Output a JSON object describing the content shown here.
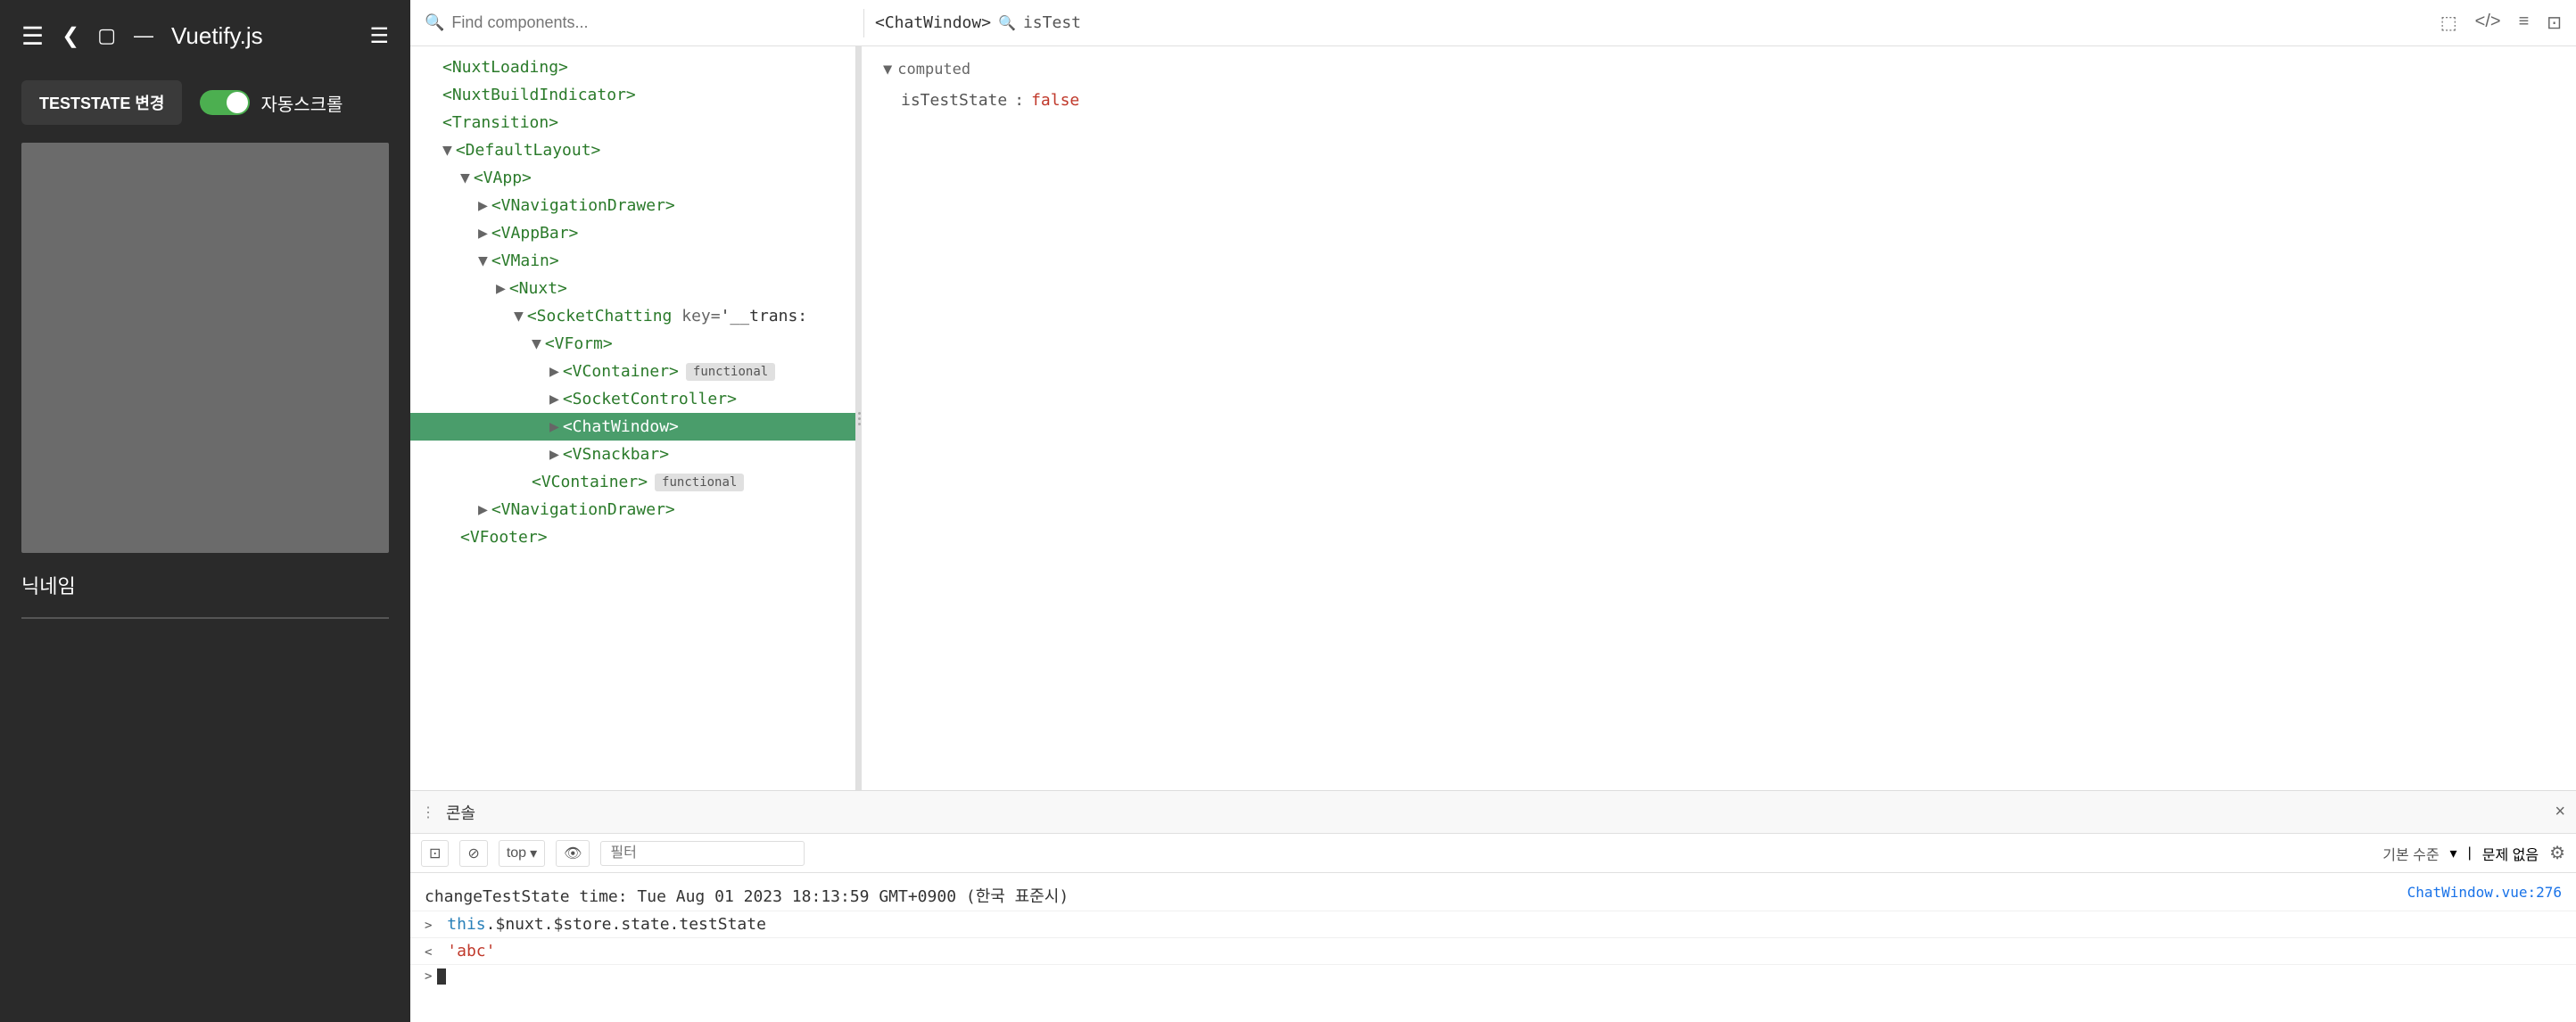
{
  "left_panel": {
    "title": "Vuetify.js",
    "test_button_label": "TESTSTATE 변경",
    "toggle_label": "자동스크롤",
    "nickname_label": "닉네임"
  },
  "devtools": {
    "search_placeholder": "Find components...",
    "breadcrumb_component": "<ChatWindow>",
    "breadcrumb_prop": "isTest",
    "component_details": {
      "section": "computed",
      "prop_key": "isTestState",
      "prop_value": "false"
    }
  },
  "component_tree": {
    "items": [
      {
        "indent": 2,
        "label": "<NuxtLoading>",
        "arrow": "",
        "badge": ""
      },
      {
        "indent": 2,
        "label": "<NuxtBuildIndicator>",
        "arrow": "",
        "badge": ""
      },
      {
        "indent": 2,
        "label": "<Transition>",
        "arrow": "",
        "badge": ""
      },
      {
        "indent": 2,
        "label": "<DefaultLayout>",
        "arrow": "▼",
        "badge": ""
      },
      {
        "indent": 3,
        "label": "<VApp>",
        "arrow": "▼",
        "badge": ""
      },
      {
        "indent": 4,
        "label": "<VNavigationDrawer>",
        "arrow": "▶",
        "badge": ""
      },
      {
        "indent": 4,
        "label": "<VAppBar>",
        "arrow": "▶",
        "badge": ""
      },
      {
        "indent": 4,
        "label": "<VMain>",
        "arrow": "▼",
        "badge": ""
      },
      {
        "indent": 5,
        "label": "<Nuxt>",
        "arrow": "▶",
        "badge": ""
      },
      {
        "indent": 6,
        "label": "<SocketChatting",
        "arrow": "▼",
        "attr_key": "key=",
        "attr_val": "'__trans:",
        "badge": ""
      },
      {
        "indent": 7,
        "label": "<VForm>",
        "arrow": "▼",
        "badge": ""
      },
      {
        "indent": 8,
        "label": "<VContainer>",
        "arrow": "▶",
        "badge": "functional"
      },
      {
        "indent": 8,
        "label": "<SocketController>",
        "arrow": "▶",
        "badge": ""
      },
      {
        "indent": 8,
        "label": "<ChatWindow>",
        "arrow": "▶",
        "badge": "",
        "selected": true
      },
      {
        "indent": 8,
        "label": "<VSnackbar>",
        "arrow": "▶",
        "badge": ""
      },
      {
        "indent": 7,
        "label": "<VContainer>",
        "arrow": "",
        "badge": "functional"
      },
      {
        "indent": 4,
        "label": "<VNavigationDrawer>",
        "arrow": "▶",
        "badge": ""
      },
      {
        "indent": 3,
        "label": "<VFooter>",
        "arrow": "",
        "badge": ""
      }
    ]
  },
  "console": {
    "title": "콘솔",
    "close_label": "×",
    "top_label": "top",
    "filter_placeholder": "필터",
    "level_label": "기본 수준",
    "no_issues_label": "문제 없음",
    "logs": [
      {
        "text": "changeTestState time: Tue Aug 01 2023 18:13:59 GMT+0900 (한국 표준시)",
        "source": "ChatWindow.vue:276"
      },
      {
        "expand": ">",
        "text": "this.$nuxt.$store.state.testState",
        "source": ""
      },
      {
        "expand": "<",
        "text": "'abc'",
        "source": "",
        "is_str": true
      },
      {
        "expand": ">",
        "text": "",
        "source": "",
        "is_cursor": true
      }
    ]
  },
  "icons": {
    "hamburger": "☰",
    "back": "❮",
    "window": "▢",
    "dash": "—",
    "menu": "☰",
    "search": "🔍",
    "screenshot": "⬚",
    "code": "</>",
    "list": "≡",
    "external": "⬡",
    "drag": "⋮",
    "block": "⊘",
    "eye": "👁",
    "settings": "⚙",
    "close": "×"
  }
}
